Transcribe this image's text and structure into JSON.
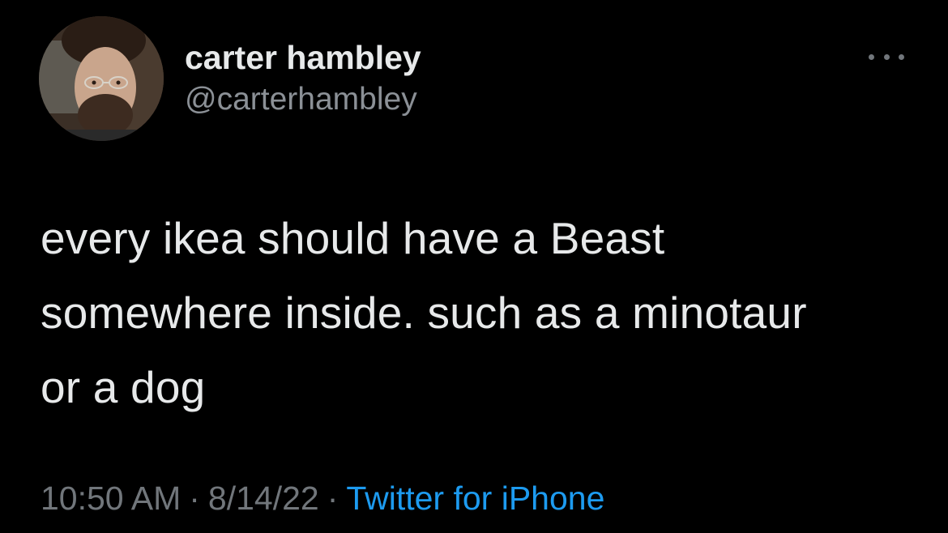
{
  "author": {
    "display_name": "carter hambley",
    "handle": "@carterhambley"
  },
  "more_icon": "more-horizontal-icon",
  "tweet": {
    "lines": [
      "every ikea should have a Beast",
      "somewhere inside. such as a minotaur",
      "or a dog"
    ]
  },
  "meta": {
    "time": "10:50 AM",
    "separator": "·",
    "date": "8/14/22",
    "source": "Twitter for iPhone"
  },
  "colors": {
    "background": "#000000",
    "primary_text": "#e7e9ea",
    "secondary_text": "#71767b",
    "link": "#1d9bf0"
  }
}
